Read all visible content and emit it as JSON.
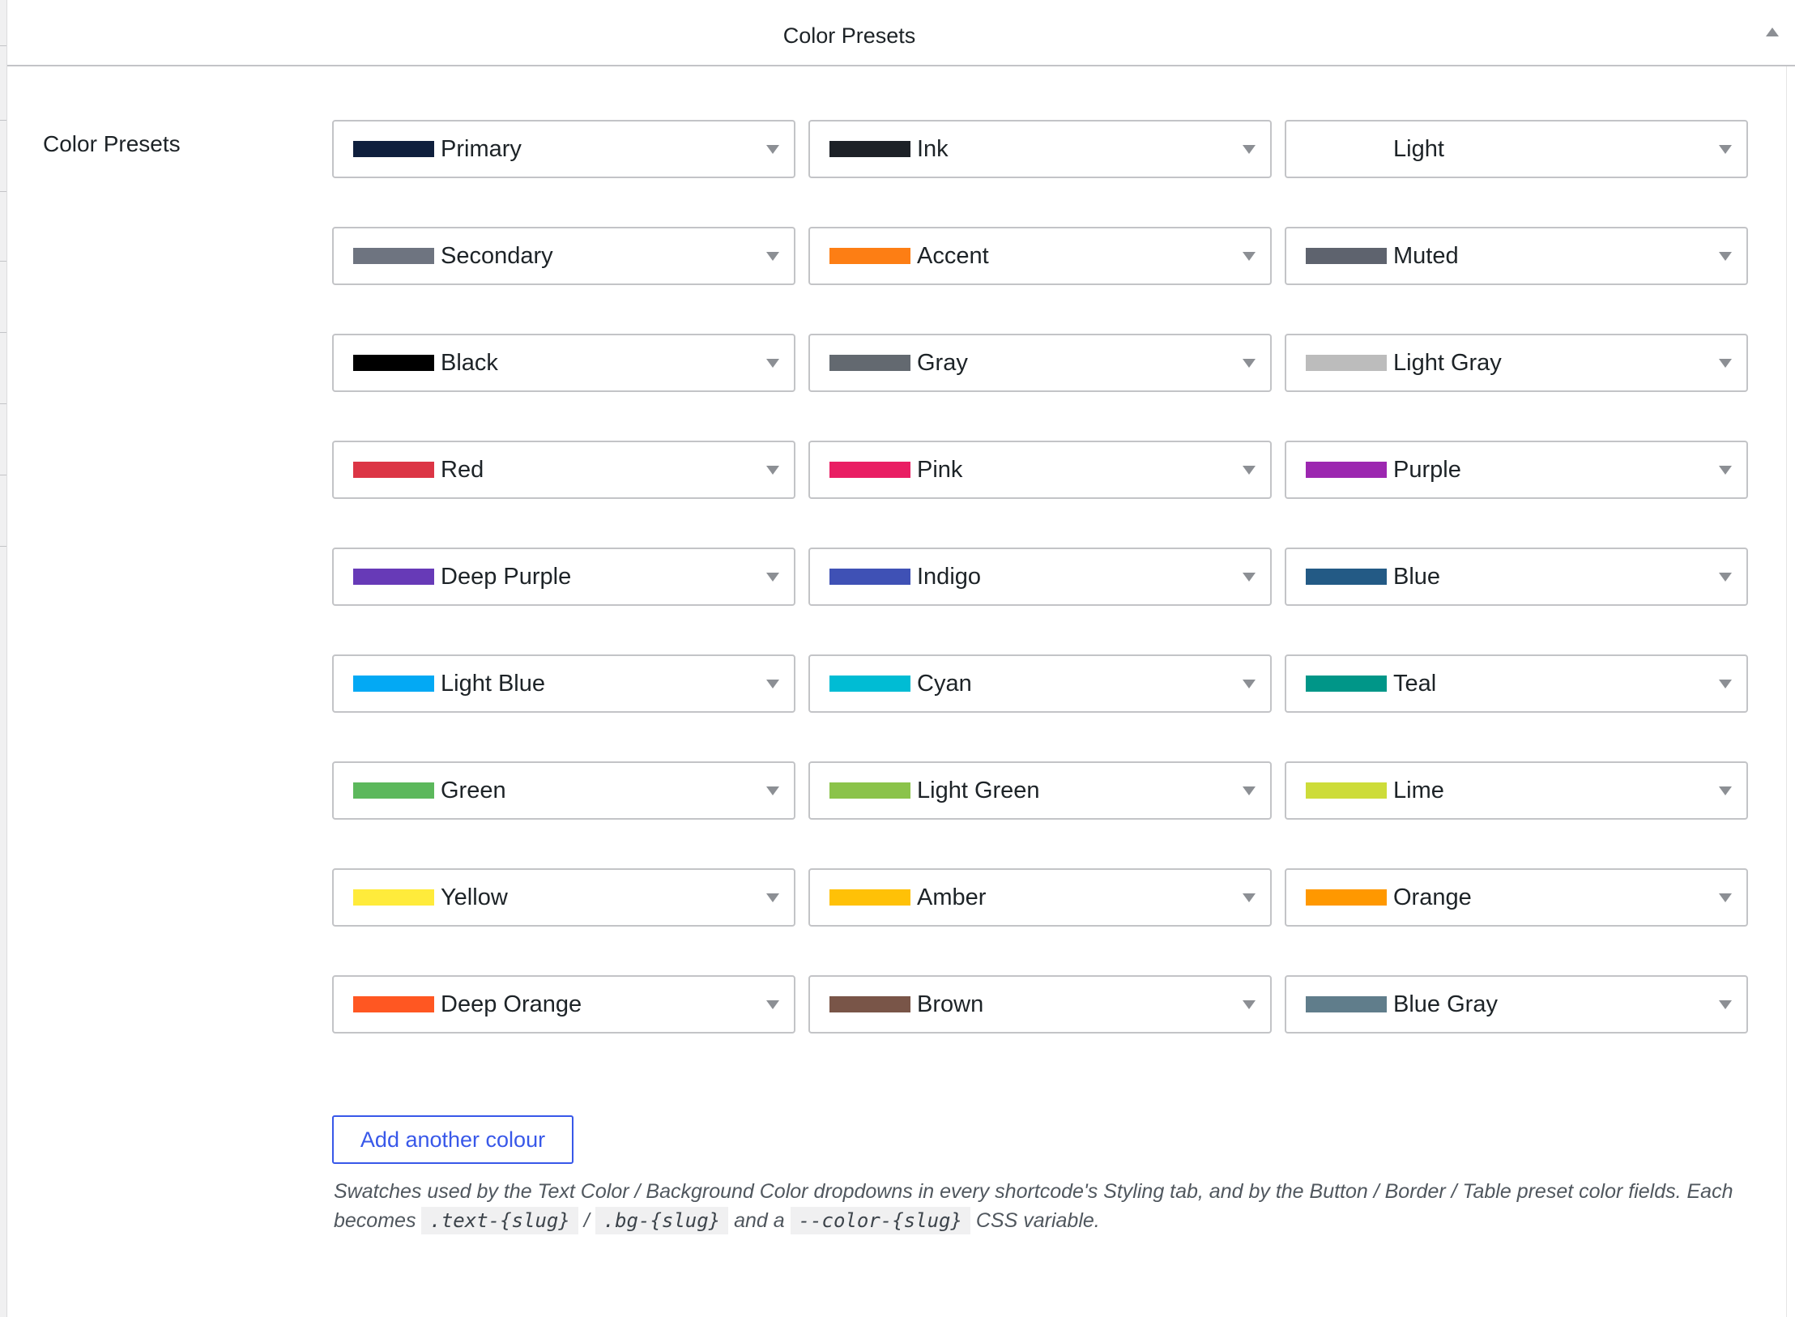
{
  "panel": {
    "title": "Color Presets",
    "collapse_icon": "triangle-up-icon"
  },
  "field": {
    "label": "Color Presets"
  },
  "presets": [
    {
      "label": "Primary",
      "color": "#0f1f3d"
    },
    {
      "label": "Ink",
      "color": "#1d2127"
    },
    {
      "label": "Light",
      "color": "#ffffff"
    },
    {
      "label": "Secondary",
      "color": "#6e7480"
    },
    {
      "label": "Accent",
      "color": "#fd7e14"
    },
    {
      "label": "Muted",
      "color": "#5e636e"
    },
    {
      "label": "Black",
      "color": "#000000"
    },
    {
      "label": "Gray",
      "color": "#636970"
    },
    {
      "label": "Light Gray",
      "color": "#bcbcbc"
    },
    {
      "label": "Red",
      "color": "#dc3545"
    },
    {
      "label": "Pink",
      "color": "#e91e63"
    },
    {
      "label": "Purple",
      "color": "#9c27b0"
    },
    {
      "label": "Deep Purple",
      "color": "#673ab7"
    },
    {
      "label": "Indigo",
      "color": "#3f51b5"
    },
    {
      "label": "Blue",
      "color": "#235a85"
    },
    {
      "label": "Light Blue",
      "color": "#03a9f4"
    },
    {
      "label": "Cyan",
      "color": "#00bcd4"
    },
    {
      "label": "Teal",
      "color": "#009688"
    },
    {
      "label": "Green",
      "color": "#5cb85c"
    },
    {
      "label": "Light Green",
      "color": "#8bc34a"
    },
    {
      "label": "Lime",
      "color": "#cddc39"
    },
    {
      "label": "Yellow",
      "color": "#ffeb3b"
    },
    {
      "label": "Amber",
      "color": "#ffc107"
    },
    {
      "label": "Orange",
      "color": "#ff9800"
    },
    {
      "label": "Deep Orange",
      "color": "#ff5722"
    },
    {
      "label": "Brown",
      "color": "#795548"
    },
    {
      "label": "Blue Gray",
      "color": "#607d8b"
    }
  ],
  "add_button": {
    "label": "Add another colour"
  },
  "help": {
    "text_1": "Swatches used by the Text Color / Background Color dropdowns in every shortcode's Styling tab, and by the Button / Border / Table preset color fields. Each becomes",
    "code_1": ".text-{slug}",
    "sep_1": "/",
    "code_2": ".bg-{slug}",
    "text_2": "and a",
    "code_3": "--color-{slug}",
    "text_3": "CSS variable."
  },
  "colors": {
    "accent": "#3858e9",
    "border": "#c3c4c7"
  }
}
